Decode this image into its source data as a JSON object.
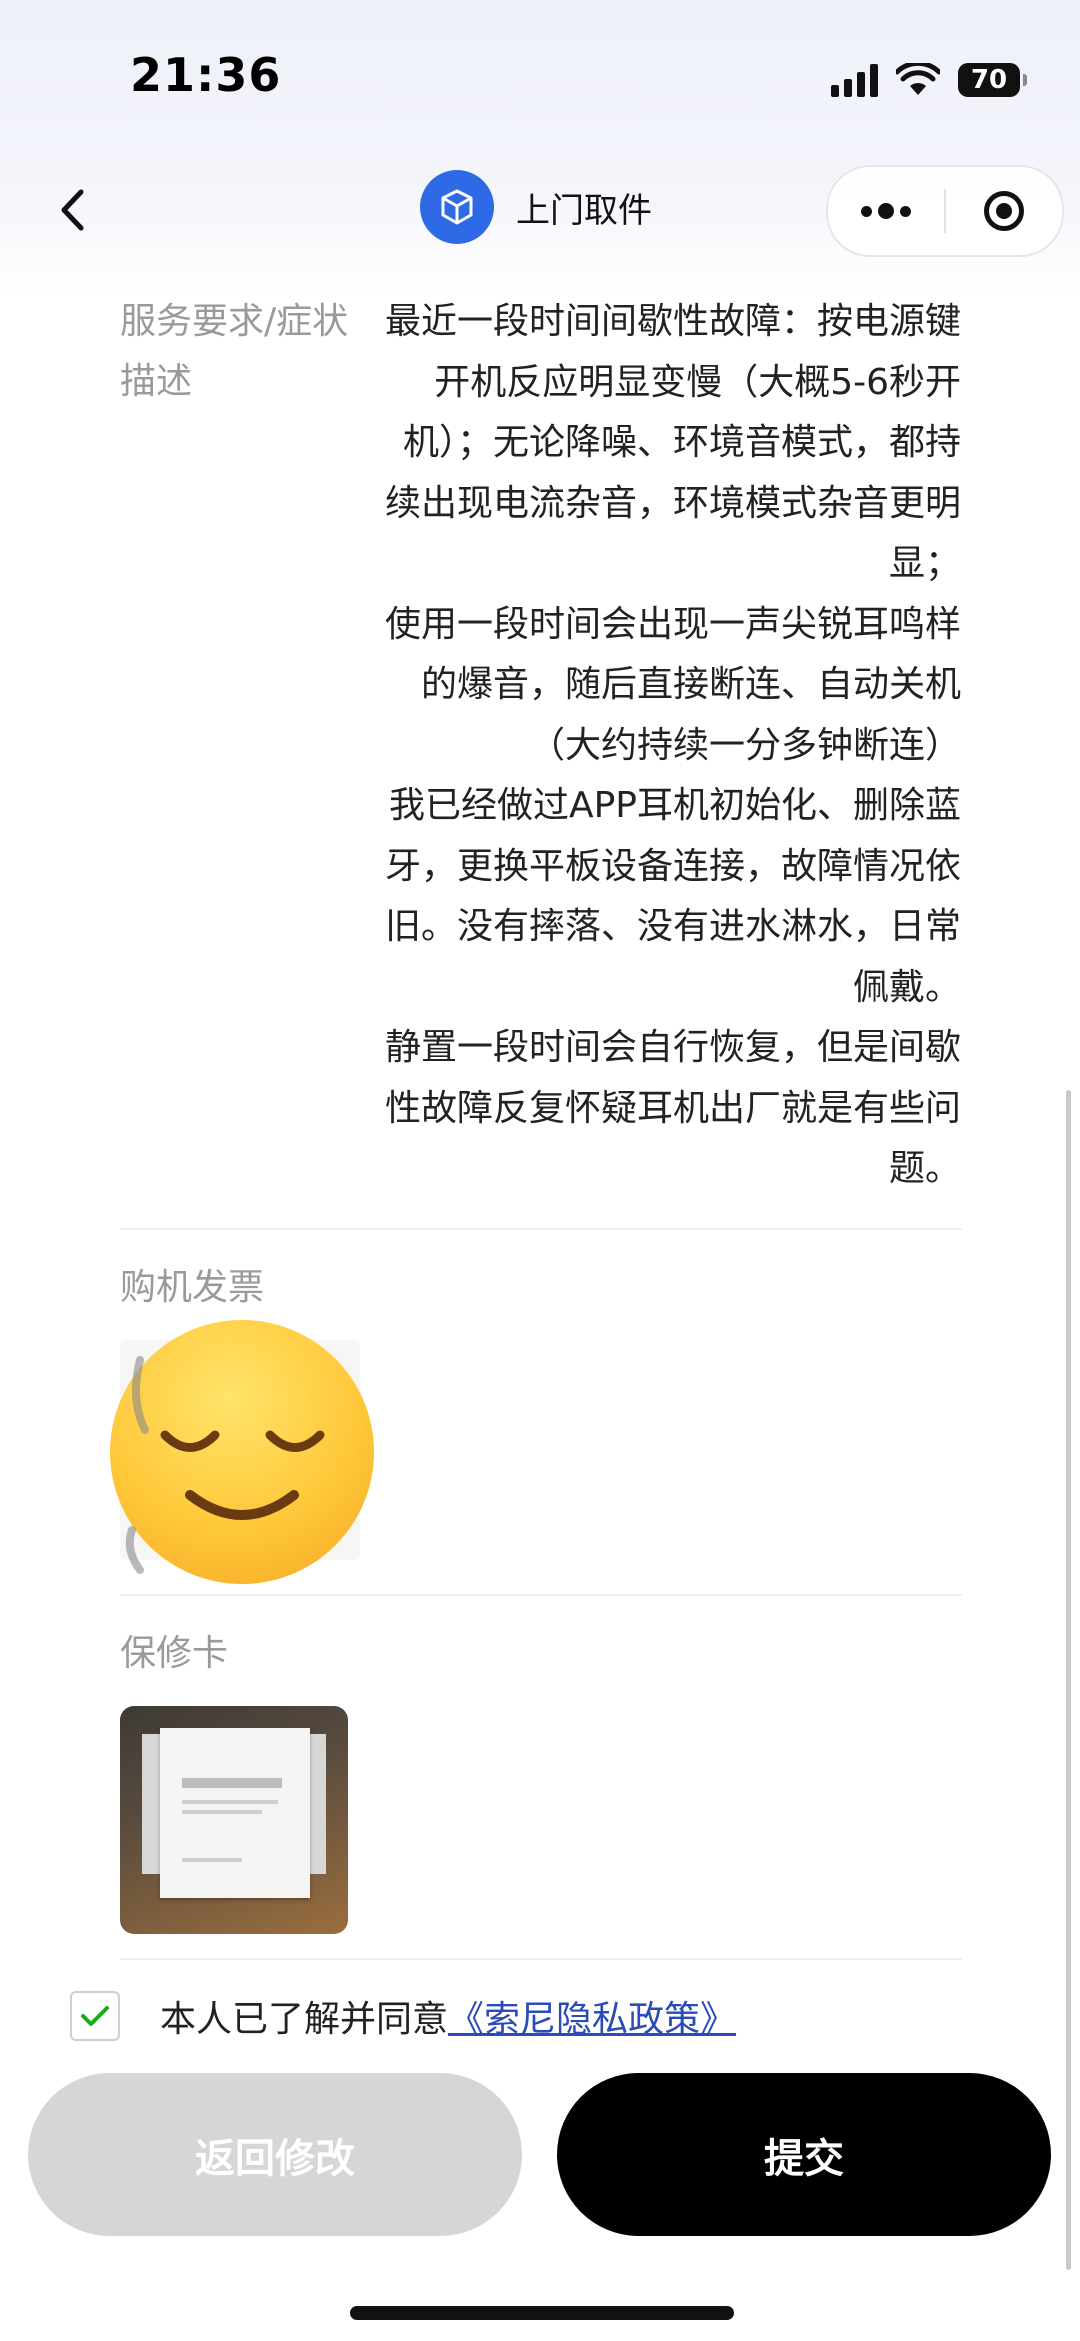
{
  "status_bar": {
    "time": "21:36",
    "battery": "70"
  },
  "nav": {
    "title": "上门取件"
  },
  "service": {
    "label": "服务要求/症状描述",
    "paragraphs": [
      "最近一段时间间歇性故障：按电源键开机反应明显变慢（大概5-6秒开机）；无论降噪、环境音模式，都持续出现电流杂音，环境模式杂音更明显；",
      "使用一段时间会出现一声尖锐耳鸣样的爆音，随后直接断连、自动关机（大约持续一分多钟断连）",
      "我已经做过APP耳机初始化、删除蓝牙，更换平板设备连接，故障情况依旧。没有摔落、没有进水淋水，日常佩戴。",
      "静置一段时间会自行恢复，但是间歇性故障反复怀疑耳机出厂就是有些问题。"
    ]
  },
  "invoice": {
    "label": "购机发票"
  },
  "warranty": {
    "label": "保修卡"
  },
  "agreement": {
    "text": "本人已了解并同意",
    "link": "《索尼隐私政策》",
    "checked": true
  },
  "buttons": {
    "back": "返回修改",
    "submit": "提交"
  }
}
